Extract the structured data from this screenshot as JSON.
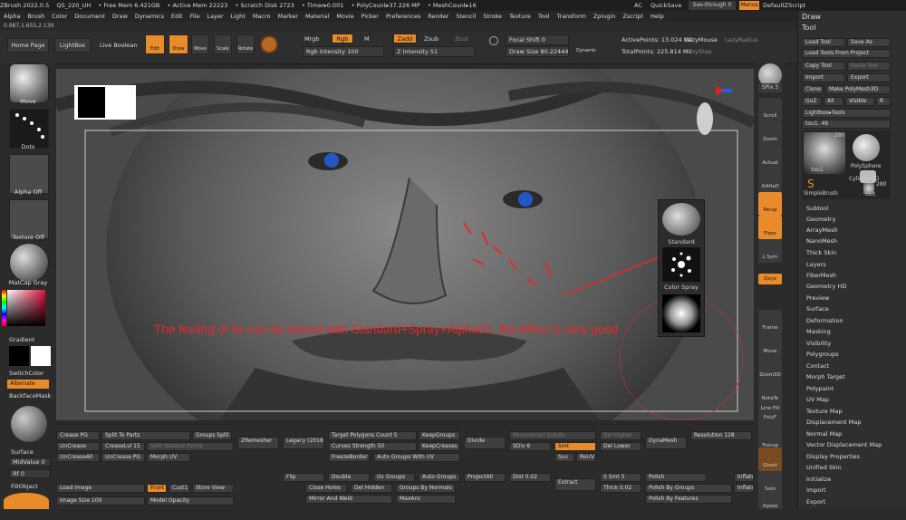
{
  "titlebar": {
    "items": [
      "ZBrush 2022.0.5",
      "QS_220_UH",
      "• Free Mem 6.421GB",
      "• Active Mem 22223",
      "• Scratch Disk 2723",
      "• Timer▸0.001",
      "• PolyCount▸37.226 MP",
      "• MeshCount▸16"
    ],
    "ac": "AC",
    "quicksave": "QuickSave",
    "see_through": "See-through  0",
    "menus": "Menus",
    "script": "DefaultZScript"
  },
  "menubar": [
    "Alpha",
    "Brush",
    "Color",
    "Document",
    "Draw",
    "Dynamics",
    "Edit",
    "File",
    "Layer",
    "Light",
    "Macro",
    "Marker",
    "Material",
    "Movie",
    "Picker",
    "Preferences",
    "Render",
    "Stencil",
    "Stroke",
    "Texture",
    "Tool",
    "Transform",
    "Zplugin",
    "Zscript",
    "Help"
  ],
  "coords": "0.987,1.655,2.139",
  "topshelf": {
    "home_page": "Home Page",
    "lightbox": "LightBox",
    "live_boolean": "Live Boolean",
    "edit": "Edit",
    "draw": "Draw",
    "move": "Move",
    "scale": "Scale",
    "rotate": "Rotate",
    "mrgb": "Mrgb",
    "rgb": "Rgb",
    "m": "M",
    "rgb_intensity": "Rgb Intensity 100",
    "zadd": "Zadd",
    "zsub": "Zsub",
    "zcut": "Zcut",
    "z_intensity": "Z Intensity 51",
    "focal_shift": "Focal Shift 0",
    "draw_size": "Draw Size 80.22444",
    "dynamic": "Dynamic",
    "active_points": "ActivePoints: 13.024 Mil",
    "total_points": "TotalPoints: 225.814 Mil",
    "lazy_mouse": "LazyMouse",
    "lazy_step": "LazyStep",
    "lazy_radius": "LazyRadius"
  },
  "lefttray": {
    "move": "Move",
    "dots": "Dots",
    "alpha_off": "Alpha Off",
    "texture_off": "Texture Off",
    "matcap": "MatCap Gray",
    "gradient": "Gradient",
    "switch_color": "SwitchColor",
    "alternate": "Alternate",
    "backface_mask": "BackfaceMask",
    "surface": "Surface",
    "mid_value": "MidValue 0",
    "rf": "Rf 0",
    "fill_object": "FillObject"
  },
  "canvas": {
    "annotation": "The feeling of lie can be solved with Standard+Spray+Alpha01, the effect is very good",
    "standard": "Standard",
    "color_spray": "Color Spray"
  },
  "rshelf": [
    "BPR",
    "SPix 3",
    "Scroll",
    "Zoom",
    "Actual",
    "AAHalf",
    "Persp",
    "Floor",
    "L.Sym",
    "Qxyz",
    "Frame",
    "Move",
    "Zoom3D",
    "RotaTe",
    "Line Fill PolyF",
    "Transp",
    "Ghost",
    "Solo",
    "Xpose"
  ],
  "rpanel": {
    "draw": "Draw",
    "tool": "Tool",
    "load_tool": "Load Tool",
    "save_as": "Save As",
    "load_from_project": "Load Tools From Project",
    "copy_tool": "Copy Tool",
    "paste_tool": "Paste Tool",
    "import": "Import",
    "export": "Export",
    "clone": "Clone",
    "make_polymesh": "Make PolyMesh3D",
    "goz": "GoZ",
    "all": "All",
    "visible": "Visible",
    "r": "R",
    "lightbox_tools": "Lightbox▸Tools",
    "tool_slider": "tou1. 49",
    "tools": [
      {
        "name": "tou1",
        "count": "280"
      },
      {
        "name": "PolySphere",
        "count": ""
      },
      {
        "name": "SimpleBrush",
        "count": ""
      },
      {
        "name": "Cylinder3D",
        "count": ""
      },
      {
        "name": "tou1",
        "count": "280"
      }
    ],
    "menu": [
      "Subtool",
      "Geometry",
      "ArrayMesh",
      "NanoMesh",
      "Thick Skin",
      "Layers",
      "FiberMesh",
      "Geometry HD",
      "Preview",
      "Surface",
      "Deformation",
      "Masking",
      "Visibility",
      "Polygroups",
      "Contact",
      "Morph Target",
      "Polypaint",
      "UV Map",
      "Texture Map",
      "Displacement Map",
      "Normal Map",
      "Vector Displacement Map",
      "Display Properties",
      "Unified Skin",
      "Initialize",
      "Import",
      "Export"
    ]
  },
  "bottom": {
    "crease_pg": "Crease PG",
    "split_to_parts": "Split To Parts",
    "groups_split": "Groups Split",
    "zremesher": "ZRemesher",
    "legacy": "Legacy (2018)",
    "target_polygons": "Target Polygons Count 5",
    "keep_groups": "KeepGroups",
    "reconstruct_subdiv": "Reconstruct Subdiv",
    "del_higher": "Del Higher",
    "dynamesh": "DynaMesh",
    "resolution": "Resolution 128",
    "uncrease": "UnCrease",
    "crease_lvl": "CreaseLvl 15",
    "split_masked": "Split Masked Points",
    "curves_strength": "Curves Strength 50",
    "keep_creases": "KeepCreases",
    "divide": "Divide",
    "sdiv": "SDiv 6",
    "smt": "Smt",
    "del_lower": "Del Lower",
    "uncrease_all": "UnCreaseAll",
    "uncrease_pg": "UnCrease PG",
    "morph_uv": "Morph UV",
    "freeze_border": "FreezeBorder",
    "auto_groups_uv": "Auto Groups With UV",
    "suv": "Suv",
    "reuv": "ReUV",
    "flip": "Flip",
    "double": "Double",
    "uv_groups": "Uv Groups",
    "auto_groups": "Auto Groups",
    "project_all": "ProjectAll",
    "dist": "Dist 0.02",
    "extract": "Extract",
    "s_smt": "S Smt 5",
    "polish": "Polish",
    "inflate1": "Inflate",
    "load_image": "Load Image",
    "front": "Front",
    "cust1": "Cust1",
    "store_view": "Store View",
    "close_holes": "Close Holes",
    "del_hidden": "Del Hidden",
    "groups_by_normals": "Groups By Normals",
    "thick": "Thick 0.02",
    "polish_by_groups": "Polish By Groups",
    "inflate2": "Inflate",
    "image_size": "Image Size 100",
    "model_opacity": "Model Opacity",
    "mirror_and_weld": "Mirror And Weld",
    "max_angle": "MaxAnc",
    "polish_by_features": "Polish By Features"
  },
  "colors": {
    "accent": "#e98b2a",
    "annotation": "#e8282a"
  }
}
